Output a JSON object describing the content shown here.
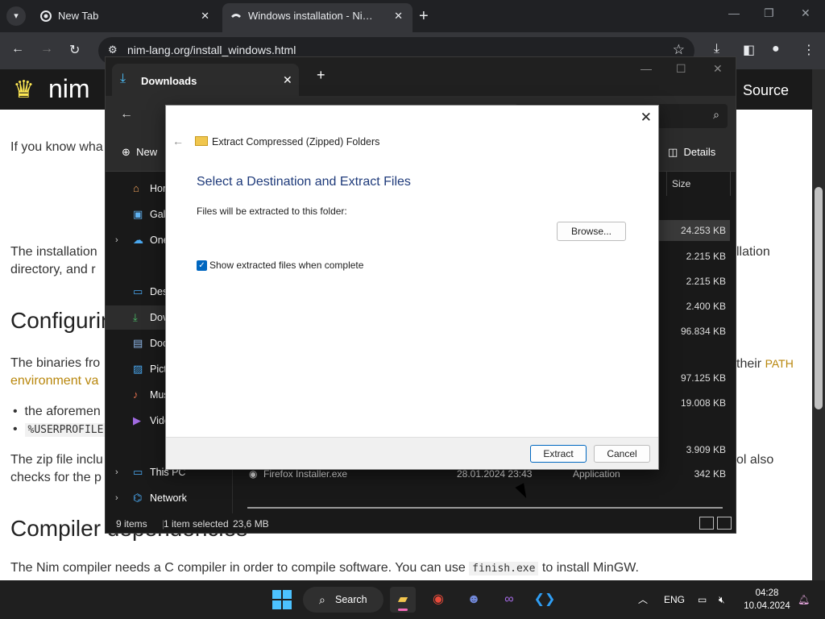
{
  "browser": {
    "tabs": [
      {
        "label": "New Tab",
        "icon": "chrome-icon"
      },
      {
        "label": "Windows installation - Nim Pro",
        "icon": "nim-icon"
      }
    ],
    "url": "nim-lang.org/install_windows.html"
  },
  "page": {
    "brand": "nim",
    "nav_source": "Source",
    "p1": "If you know wha",
    "p2a": "The installation",
    "p2b": "directory, and r",
    "p2c": "llation",
    "h2_config": "Configurin",
    "p3a": "The binaries fro",
    "p3b": "their",
    "p3_path": "PATH",
    "p3c": "environment va",
    "bullet1": "the aforemen",
    "bullet2": "%USERPROFILE",
    "p4a": "The zip file inclu",
    "p4b": "checks for the p",
    "p4c": "ol also",
    "h2_compiler": "Compiler dependencies",
    "p5_before": "The Nim compiler needs a C compiler in order to compile software. You can use",
    "p5_code": "finish.exe",
    "p5_after": "to install MinGW."
  },
  "explorer": {
    "tab_label": "Downloads",
    "new_label": "New",
    "details_label": "Details",
    "sidebar": [
      {
        "label": "Hor",
        "icon": "home-icon",
        "chevron": false
      },
      {
        "label": "Gall",
        "icon": "gallery-icon",
        "chevron": false
      },
      {
        "label": "One",
        "icon": "onedrive-icon",
        "chevron": true
      },
      {
        "label": "Desl",
        "icon": "desktop-icon",
        "chevron": false
      },
      {
        "label": "Dov",
        "icon": "downloads-icon",
        "chevron": false
      },
      {
        "label": "Doc",
        "icon": "documents-icon",
        "chevron": false
      },
      {
        "label": "Pict",
        "icon": "pictures-icon",
        "chevron": false
      },
      {
        "label": "Mus",
        "icon": "music-icon",
        "chevron": false
      },
      {
        "label": "Vide",
        "icon": "videos-icon",
        "chevron": false
      },
      {
        "label": "This PC",
        "icon": "this-pc-icon",
        "chevron": true
      },
      {
        "label": "Network",
        "icon": "network-icon",
        "chevron": true
      }
    ],
    "size_header": "Size",
    "sizes": [
      "24.253 KB",
      "2.215 KB",
      "2.215 KB",
      "2.400 KB",
      "96.834 KB",
      "97.125 KB",
      "19.008 KB",
      "3.909 KB"
    ],
    "firefox_row": {
      "name": "Firefox Installer.exe",
      "date": "28.01.2024 23:43",
      "type": "Application",
      "size": "342 KB"
    },
    "status_items": "9 items",
    "status_selected": "1 item selected",
    "status_size": "23,6 MB"
  },
  "dialog": {
    "title": "Extract Compressed (Zipped) Folders",
    "heading": "Select a Destination and Extract Files",
    "label": "Files will be extracted to this folder:",
    "browse": "Browse...",
    "checkbox_label": "Show extracted files when complete",
    "checkbox_checked": true,
    "extract": "Extract",
    "cancel": "Cancel"
  },
  "taskbar": {
    "search": "Search",
    "lang": "ENG",
    "time": "04:28",
    "date": "10.04.2024"
  }
}
